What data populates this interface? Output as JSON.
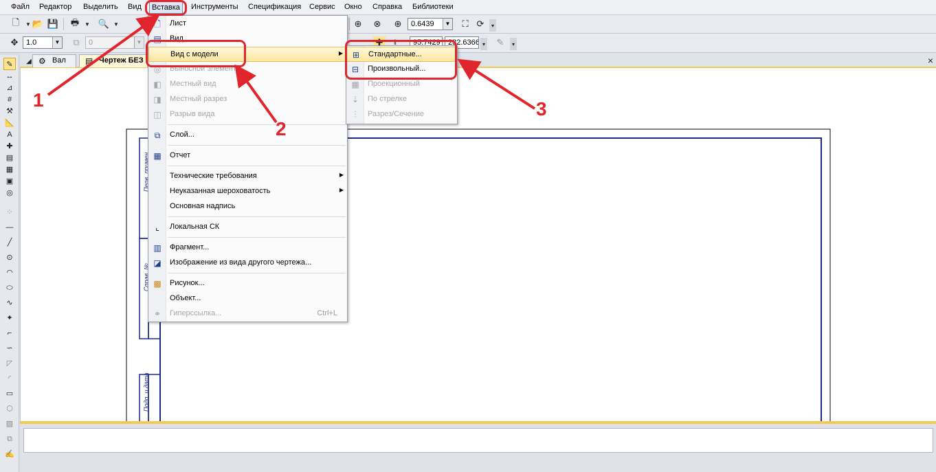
{
  "menubar": {
    "items": [
      "Файл",
      "Редактор",
      "Выделить",
      "Вид",
      "Вставка",
      "Инструменты",
      "Спецификация",
      "Сервис",
      "Окно",
      "Справка",
      "Библиотеки"
    ]
  },
  "toolbar": {
    "zoom_value": "0.6439",
    "step_value": "1.0",
    "layer_value": "0",
    "coord_x": "95.7429",
    "coord_y": "232.6366"
  },
  "tabs": [
    {
      "label": "Вал"
    },
    {
      "label": "Чертеж БЕЗ"
    }
  ],
  "insert_menu": {
    "items": [
      {
        "label": "Лист",
        "icon": "sheet-icon",
        "enabled": true
      },
      {
        "label": "Вид",
        "icon": "view-icon",
        "enabled": true
      },
      {
        "label": "Вид с модели",
        "icon": "",
        "enabled": true,
        "submenu": true
      },
      {
        "label": "Выносной элемент",
        "icon": "detail-icon",
        "enabled": false
      },
      {
        "label": "Местный вид",
        "icon": "local-view-icon",
        "enabled": false
      },
      {
        "label": "Местный разрез",
        "icon": "local-section-icon",
        "enabled": false
      },
      {
        "label": "Разрыв вида",
        "icon": "break-view-icon",
        "enabled": false
      },
      {
        "label": "Слой...",
        "icon": "layer-icon",
        "enabled": true
      },
      {
        "label": "Отчет",
        "icon": "report-icon",
        "enabled": true
      },
      {
        "label": "Технические требования",
        "icon": "",
        "enabled": true,
        "submenu": true
      },
      {
        "label": "Неуказанная шероховатость",
        "icon": "",
        "enabled": true,
        "submenu": true
      },
      {
        "label": "Основная надпись",
        "icon": "",
        "enabled": true
      },
      {
        "label": "Локальная СК",
        "icon": "local-cs-icon",
        "enabled": true
      },
      {
        "label": "Фрагмент...",
        "icon": "fragment-icon",
        "enabled": true
      },
      {
        "label": "Изображение из вида другого чертежа...",
        "icon": "image-from-view-icon",
        "enabled": true
      },
      {
        "label": "Рисунок...",
        "icon": "picture-icon",
        "enabled": true
      },
      {
        "label": "Объект...",
        "icon": "",
        "enabled": true
      },
      {
        "label": "Гиперссылка...",
        "icon": "hyperlink-icon",
        "enabled": false,
        "shortcut": "Ctrl+L"
      }
    ]
  },
  "model_view_submenu": {
    "items": [
      {
        "label": "Стандартные...",
        "icon": "standard-views-icon",
        "enabled": true
      },
      {
        "label": "Произвольный...",
        "icon": "arbitrary-view-icon",
        "enabled": true
      },
      {
        "label": "Проекционный",
        "icon": "projection-view-icon",
        "enabled": false
      },
      {
        "label": "По стрелке",
        "icon": "arrow-view-icon",
        "enabled": false
      },
      {
        "label": "Разрез/Сечение",
        "icon": "section-icon",
        "enabled": false
      }
    ]
  },
  "annotations": {
    "step1": "1",
    "step2": "2",
    "step3": "3",
    "color": "#e0252c"
  },
  "drawing": {
    "stamp_texts": [
      "Перв. примен.",
      "Справ. №",
      "Подп. и дата"
    ]
  }
}
